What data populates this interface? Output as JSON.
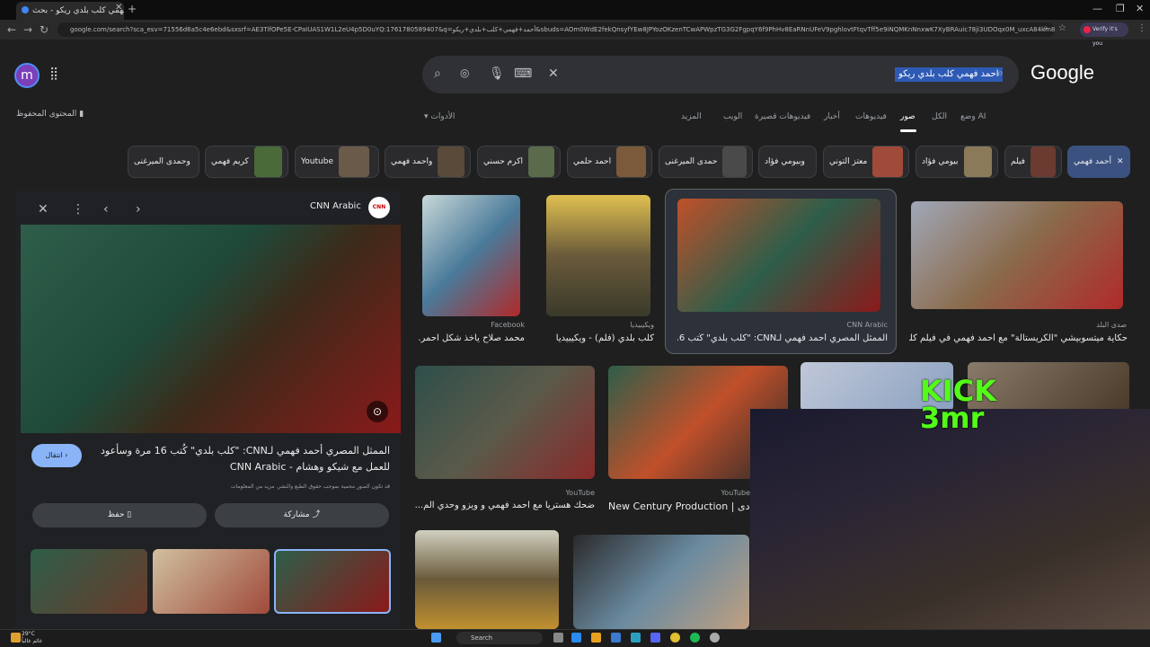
{
  "browser": {
    "tab_title": "أحمد فهمي كلب بلدي ريكو - بحث",
    "url": "google.com/search?sca_esv=71556d6a5c4e6ebd&sxsrf=AE3TifOPe5E-CPaIUAS1W1L2eU4p5D0uYQ:1761780589407&q=أحمد+فهمي+كلب+بلدي+ريكو&sbuds=AOm0WdE2fekQnsyfYEw8JPYozOKzenTCwAPWpzTG3G2FgpqY6f9PhHv8EaRNnUFeV9pghlovtFtqvTff5e9iNQMKnNnxwK7XyBRAuic78ji3UDOqx0M_uxcA84km80VjnP5BJu0PAxrcxvRpkI3BUZG88",
    "verify_label": "Verify it's you"
  },
  "search": {
    "query": "احمد فهمي كلب بلدي ريكو",
    "logo": "Google"
  },
  "avatar_letter": "m",
  "nav_tabs": [
    "وضع AI",
    "الكل",
    "صور",
    "فيديوهات",
    "أخبار",
    "فيديوهات قصيرة",
    "الويب",
    "المزيد"
  ],
  "tools_label": "الأدوات",
  "saved_label": "المحتوى المحفوظ",
  "chips": [
    "أحمد فهمي",
    "فيلم",
    "بيومي فؤاد",
    "معتز التوني",
    "وبيومي فؤاد",
    "حمدى الميرغنى",
    "احمد حلمي",
    "اكرم حسني",
    "واحمد فهمي",
    "Youtube",
    "كريم فهمي",
    "وحمدى الميرغنى"
  ],
  "panel": {
    "source": "CNN Arabic",
    "source_logo": "CNN",
    "title": "الممثل المصري أحمد فهمي لـCNN: \"كلب بلدي\" كُتب 16 مرة وسأعود للعمل مع شيكو وهشام - CNN Arabic",
    "go_button": "انتقال",
    "copyright": "قد تكون الصور محمية بموجب حقوق الطبع والنشر. مزيد من المعلومات",
    "share_button": "مشاركة",
    "save_button": "حفظ"
  },
  "results": [
    {
      "source": "صدى البلد",
      "title": "حكاية ميتسوبيشي \"الكريستالة\" مع أحمد فهمي في فيلم كلب بل..."
    },
    {
      "source": "CNN Arabic",
      "title": "الممثل المصري أحمد فهمي لـCNN: \"كلب بلدي\" كُتب 6..."
    },
    {
      "source": "ويكيبيديا",
      "title": "كلب بلدي (فلم) - ويكيبيديا"
    },
    {
      "source": "Facebook",
      "title": "محمد صلاح يأخذ شكل احمر..."
    },
    {
      "source": "YouTube",
      "title": "ضحك هستريا مع احمد فهمي و ويزو وحدي الم..."
    },
    {
      "source": "YouTube",
      "title": "New Century Production | دى"
    }
  ],
  "overlay": {
    "brand_top": "KICK",
    "brand_bottom": "3mr"
  },
  "taskbar": {
    "search_label": "Search",
    "weather_temp": "29°C",
    "weather_desc": "غائم غالباً"
  }
}
